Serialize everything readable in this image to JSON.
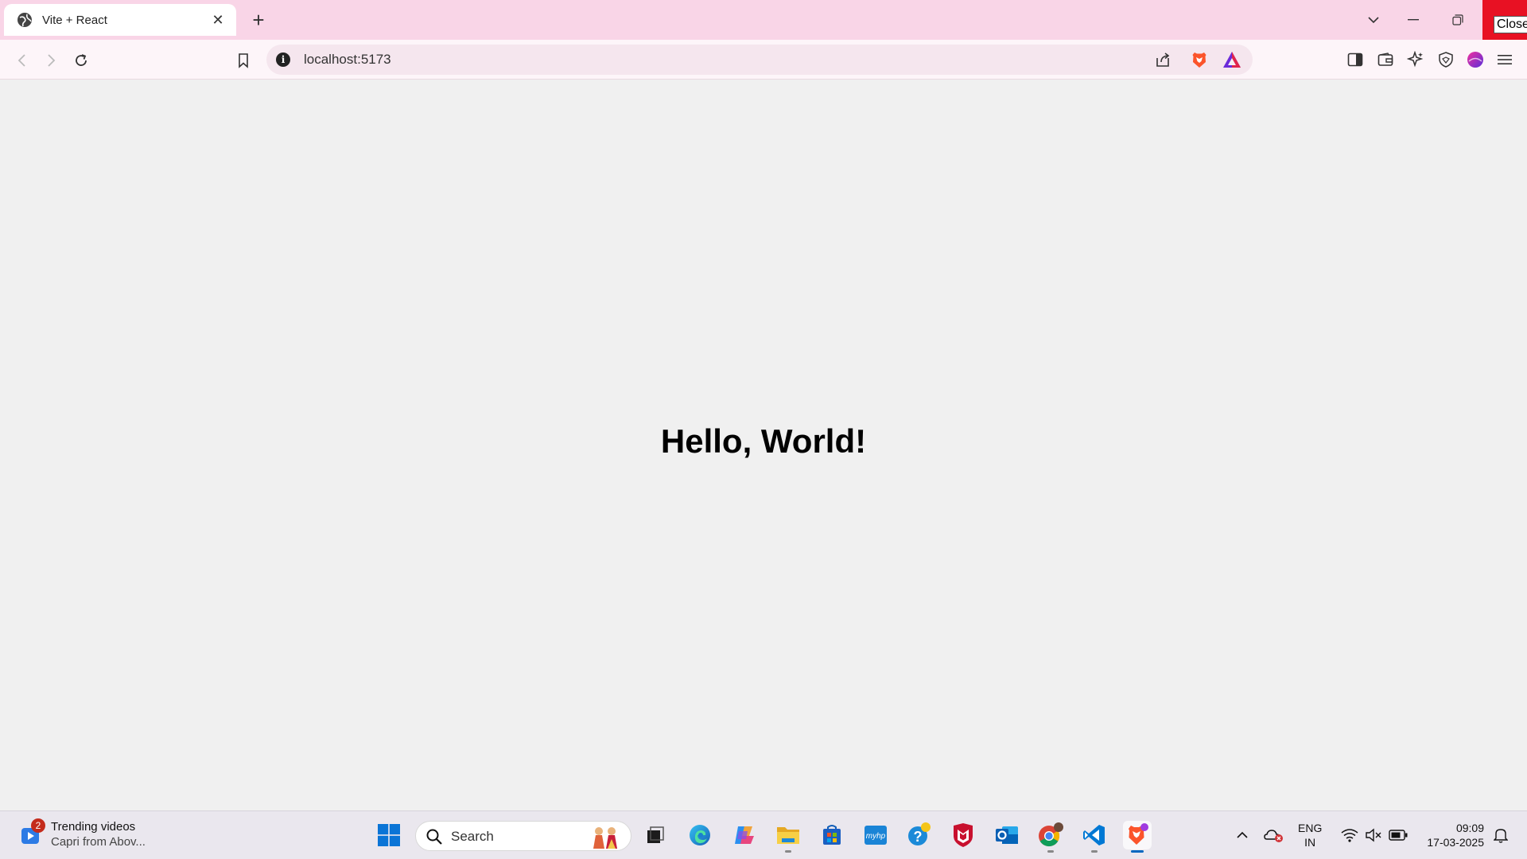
{
  "browser": {
    "tab": {
      "title": "Vite + React",
      "favicon": "globe-icon"
    },
    "close_tooltip": "Close",
    "address": {
      "url": "localhost:5173"
    }
  },
  "page": {
    "heading": "Hello, World!"
  },
  "taskbar": {
    "widget": {
      "badge": "2",
      "line1": "Trending videos",
      "line2": "Capri from Abov..."
    },
    "search": {
      "placeholder": "Search"
    },
    "lang": {
      "line1": "ENG",
      "line2": "IN"
    },
    "clock": {
      "time": "09:09",
      "date": "17-03-2025"
    }
  },
  "colors": {
    "tabbar": "#f9d5e7",
    "close_red": "#e81123",
    "accent": "#0067c0"
  }
}
